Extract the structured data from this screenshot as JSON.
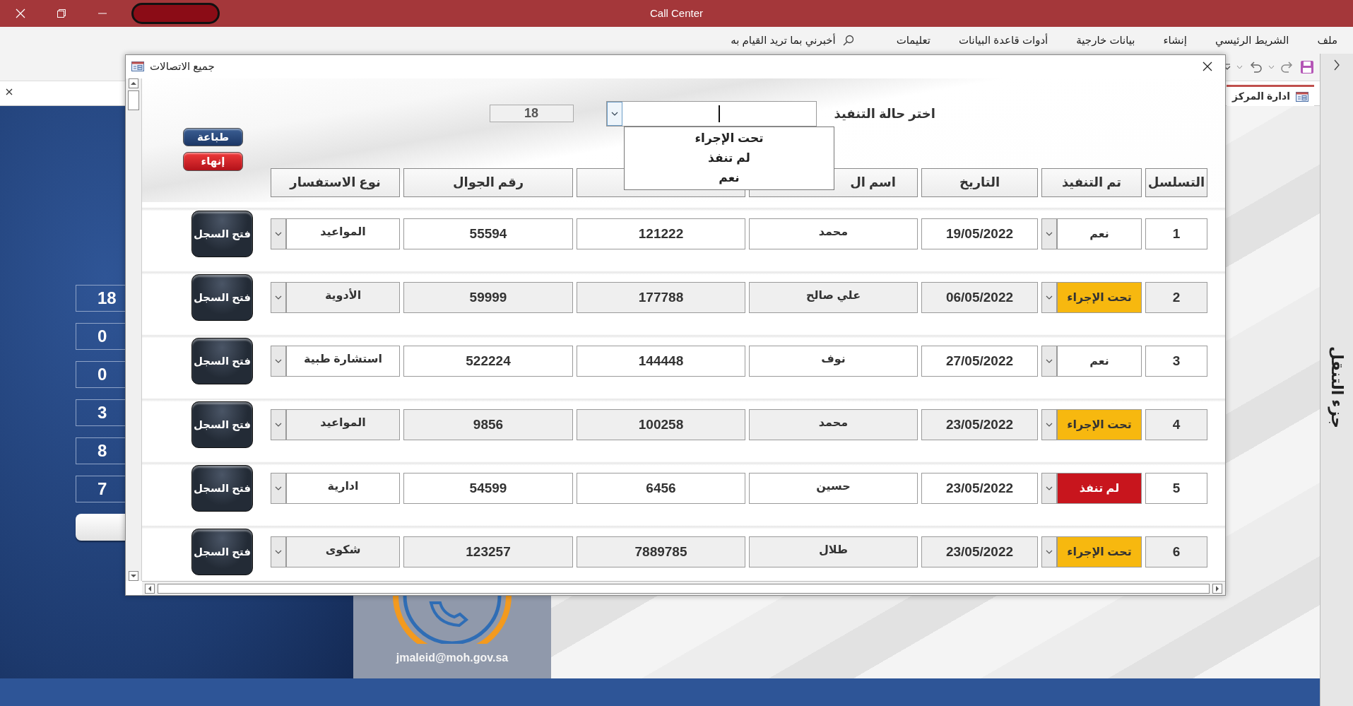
{
  "app": {
    "title": "Call Center"
  },
  "menu": [
    "ملف",
    "الشريط الرئيسي",
    "إنشاء",
    "بيانات خارجية",
    "أدوات قاعدة البيانات",
    "تعليمات"
  ],
  "tell_me": {
    "placeholder": "أخبرني بما تريد القيام به"
  },
  "document_tab": {
    "title": "ادارة المركز",
    "selected": true
  },
  "background_form": {
    "counters": [
      "18",
      "0",
      "0",
      "3",
      "8",
      "7"
    ],
    "email": "jmaleid@moh.gov.sa"
  },
  "nav_pane": {
    "title": "جزء التنقل"
  },
  "popup": {
    "title": "جميع الاتصالات",
    "filter": {
      "label": "اختر حالة التنفيذ",
      "expanded": true,
      "options": [
        "تحت الإجراء",
        "لم تنفذ",
        "نعم"
      ]
    },
    "count": "18",
    "buttons": [
      {
        "label": "طباعة",
        "kind": "print"
      },
      {
        "label": "إنهاء",
        "kind": "exit"
      }
    ],
    "table": {
      "columns": {
        "seq": "التسلسل",
        "status": "تم التنفيذ",
        "date": "التاريخ",
        "name": "اسم ال",
        "phone": "رقم الجوال",
        "inquiry": "نوع الاستفسار"
      },
      "rows": [
        {
          "seq": "1",
          "status": {
            "text": "نعم",
            "color": "#ffffff"
          },
          "date": "19/05/2022",
          "name": "محمد",
          "column_5": "121222",
          "phone": "55594",
          "inquiry": "المواعيد",
          "shaded": false,
          "open_button": "فتح السجل"
        },
        {
          "seq": "2",
          "status": {
            "text": "تحت الإجراء",
            "color": "#f7b80f"
          },
          "date": "06/05/2022",
          "name": "علي صالح",
          "column_5": "177788",
          "phone": "59999",
          "inquiry": "الأدوية",
          "shaded": true,
          "open_button": "فتح السجل"
        },
        {
          "seq": "3",
          "status": {
            "text": "نعم",
            "color": "#ffffff"
          },
          "date": "27/05/2022",
          "name": "نوف",
          "column_5": "144448",
          "phone": "522224",
          "inquiry": "استشارة طبية",
          "shaded": false,
          "open_button": "فتح السجل"
        },
        {
          "seq": "4",
          "status": {
            "text": "تحت الإجراء",
            "color": "#f7b80f"
          },
          "date": "23/05/2022",
          "name": "محمد",
          "column_5": "100258",
          "phone": "9856",
          "inquiry": "المواعيد",
          "shaded": true,
          "open_button": "فتح السجل"
        },
        {
          "seq": "5",
          "status": {
            "text": "لم تنفذ",
            "color": "#c8151d"
          },
          "date": "23/05/2022",
          "name": "حسين",
          "column_5": "6456",
          "phone": "54599",
          "inquiry": "ادارية",
          "shaded": false,
          "open_button": "فتح السجل"
        },
        {
          "seq": "6",
          "status": {
            "text": "تحت الإجراء",
            "color": "#f7b80f"
          },
          "date": "23/05/2022",
          "name": "طلال",
          "column_5": "7889785",
          "phone": "123257",
          "inquiry": "شكوى",
          "shaded": true,
          "open_button": "فتح السجل"
        }
      ]
    }
  }
}
